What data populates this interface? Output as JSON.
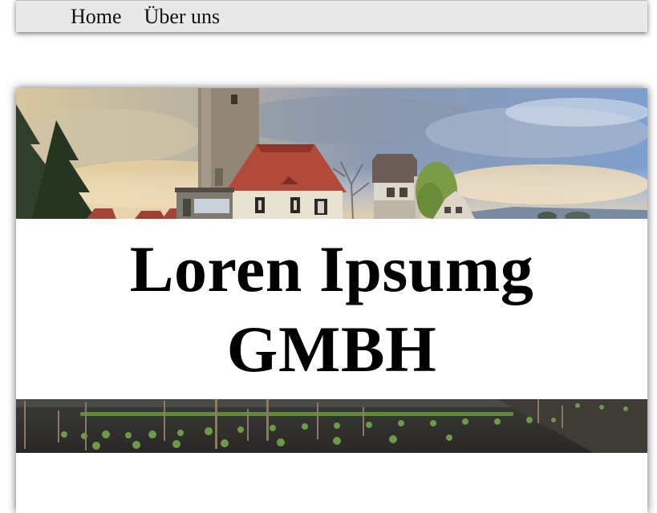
{
  "nav": {
    "items": [
      {
        "label": "Home"
      },
      {
        "label": "Über uns"
      }
    ]
  },
  "hero": {
    "title_line1": "Loren Ipsumg",
    "title_line2": "GMBH"
  },
  "colors": {
    "nav_background": "#e8e8e8",
    "roof": "#b24a3a",
    "sky_light": "#e9d6b0",
    "sky_blue": "#8ea6c8"
  }
}
